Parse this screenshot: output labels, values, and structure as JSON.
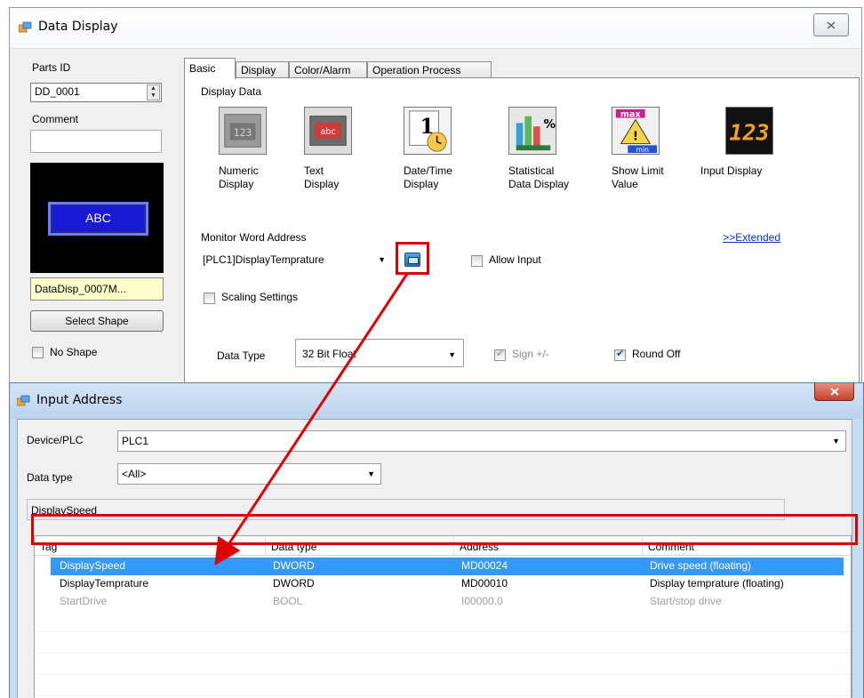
{
  "data_display": {
    "title": "Data Display",
    "parts_id_label": "Parts ID",
    "parts_id_value": "DD_0001",
    "comment_label": "Comment",
    "preview_text": "ABC",
    "preview_name": "DataDisp_0007M...",
    "select_shape_label": "Select Shape",
    "no_shape_label": "No Shape",
    "tabs": [
      {
        "label": "Basic",
        "active": true
      },
      {
        "label": "Display"
      },
      {
        "label": "Color/Alarm"
      },
      {
        "label": "Operation Process"
      }
    ],
    "display_data_label": "Display Data",
    "display_types": [
      {
        "label1": "Numeric",
        "label2": "Display",
        "icon": "numeric-display-icon"
      },
      {
        "label1": "Text",
        "label2": "Display",
        "icon": "text-display-icon"
      },
      {
        "label1": "Date/Time",
        "label2": "Display",
        "icon": "date-time-display-icon"
      },
      {
        "label1": "Statistical",
        "label2": "Data Display",
        "icon": "statistical-data-display-icon"
      },
      {
        "label1": "Show Limit",
        "label2": "Value",
        "icon": "show-limit-value-icon"
      },
      {
        "label1": "Input Display",
        "label2": "",
        "icon": "input-display-icon"
      }
    ],
    "monitor_word_address_label": "Monitor Word Address",
    "extended_link": ">>Extended",
    "monitor_address_value": "[PLC1]DisplayTemprature",
    "allow_input_label": "Allow Input",
    "scaling_settings_label": "Scaling Settings",
    "data_type_label": "Data Type",
    "data_type_value": "32 Bit Float",
    "sign_label": "Sign +/-",
    "round_off_label": "Round Off"
  },
  "input_address": {
    "title": "Input Address",
    "device_label": "Device/PLC",
    "device_value": "PLC1",
    "data_type_label": "Data type",
    "data_type_value": "<All>",
    "search_value": "DisplaySpeed",
    "columns": [
      "Tag",
      "Data type",
      "Address",
      "Comment"
    ],
    "rows": [
      {
        "tag": "DisplaySpeed",
        "type": "DWORD",
        "address": "MD00024",
        "comment": "Drive speed (floating)",
        "state": "selected"
      },
      {
        "tag": "DisplayTemprature",
        "type": "DWORD",
        "address": "MD00010",
        "comment": "Display temprature (floating)",
        "state": "normal"
      },
      {
        "tag": "StartDrive",
        "type": "BOOL",
        "address": "I00000.0",
        "comment": "Start/stop drive",
        "state": "disabled"
      }
    ]
  },
  "colors": {
    "selection": "#3399ff",
    "annotation_red": "#e00000",
    "link_blue": "#0033cc"
  }
}
